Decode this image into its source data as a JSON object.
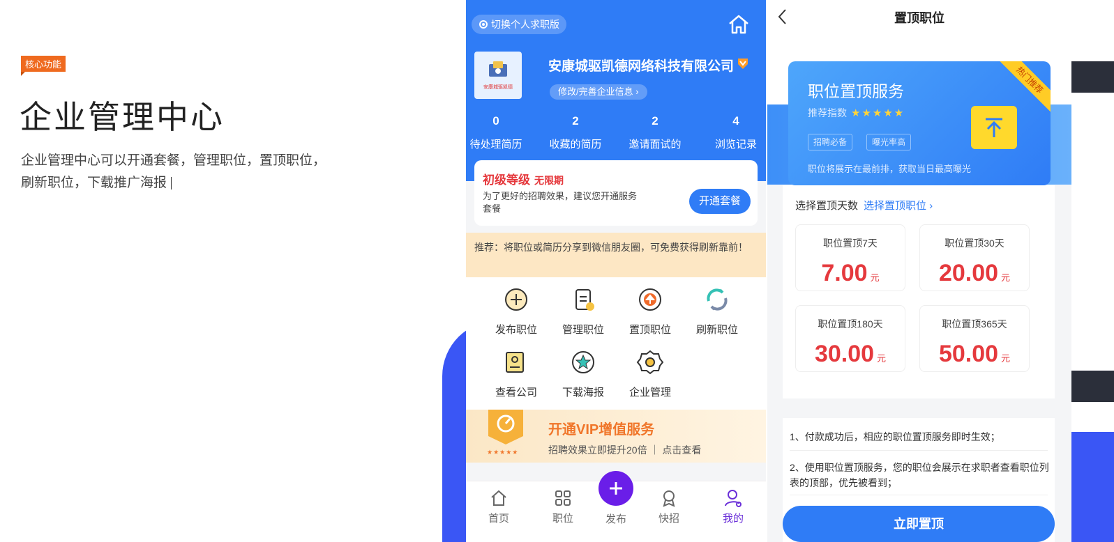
{
  "intro": {
    "tag": "核心功能",
    "title": "企业管理中心",
    "desc_line1": "企业管理中心可以开通套餐，管理职位，置顶职位，",
    "desc_line2": "刷新职位，下载推广海报"
  },
  "phone1": {
    "switch_label": "切换个人求职版",
    "logo_text": "安康城驱凯德",
    "company_name": "安康城驱凯德网络科技有限公司",
    "edit_label": "修改/完善企业信息 ›",
    "stats": [
      {
        "value": "0",
        "label": "待处理简历"
      },
      {
        "value": "2",
        "label": "收藏的简历"
      },
      {
        "value": "2",
        "label": "邀请面试的"
      },
      {
        "value": "4",
        "label": "浏览记录"
      }
    ],
    "level": {
      "title": "初级等级",
      "sub": "无限期",
      "desc": "为了更好的招聘效果，建议您开通服务套餐",
      "button": "开通套餐"
    },
    "tip": "推荐：将职位或简历分享到微信朋友圈，可免费获得刷新靠前！",
    "grid": [
      {
        "label": "发布职位",
        "icon": "plus-circle-icon"
      },
      {
        "label": "管理职位",
        "icon": "clipboard-icon"
      },
      {
        "label": "置顶职位",
        "icon": "arrow-up-circle-icon"
      },
      {
        "label": "刷新职位",
        "icon": "refresh-icon"
      },
      {
        "label": "查看公司",
        "icon": "company-card-icon"
      },
      {
        "label": "下载海报",
        "icon": "star-badge-icon"
      },
      {
        "label": "企业管理",
        "icon": "gear-icon"
      }
    ],
    "vip": {
      "title": "开通VIP增值服务",
      "sub": "招聘效果立即提升20倍 ｜ 点击查看",
      "stars": "★★★★★"
    },
    "tabs": [
      {
        "label": "首页",
        "icon": "home-icon"
      },
      {
        "label": "职位",
        "icon": "grid-icon"
      },
      {
        "label": "发布",
        "icon": "plus-icon"
      },
      {
        "label": "快招",
        "icon": "medal-icon"
      },
      {
        "label": "我的",
        "icon": "user-icon"
      }
    ]
  },
  "phone2": {
    "title": "置顶职位",
    "service": {
      "title": "职位置顶服务",
      "recommend_label": "推荐指数",
      "stars": "★★★★★",
      "tags": [
        "招聘必备",
        "曝光率高"
      ],
      "note": "职位将展示在最前排，获取当日最高曝光",
      "ribbon": "热门推荐"
    },
    "select_label": "选择置顶天数",
    "select_link": "选择置顶职位 ›",
    "prices": [
      {
        "label": "职位置顶7天",
        "value": "7.00",
        "unit": "元"
      },
      {
        "label": "职位置顶30天",
        "value": "20.00",
        "unit": "元"
      },
      {
        "label": "职位置顶180天",
        "value": "30.00",
        "unit": "元"
      },
      {
        "label": "职位置顶365天",
        "value": "50.00",
        "unit": "元"
      }
    ],
    "notes": [
      "1、付款成功后，相应的职位置顶服务即时生效；",
      "2、使用职位置顶服务，您的职位会展示在求职者查看职位列表的顶部，优先被看到；"
    ],
    "button": "立即置顶"
  },
  "colors": {
    "brand_blue": "#2f7cf6",
    "accent_red": "#e5393d",
    "accent_orange": "#f0762a",
    "active_purple": "#6a2fd8"
  }
}
